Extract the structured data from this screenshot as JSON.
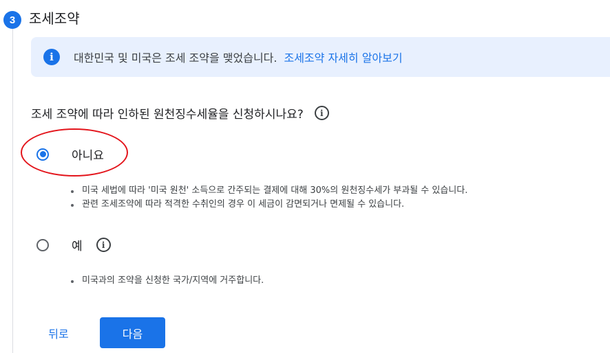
{
  "step": {
    "number": "3",
    "title": "조세조약"
  },
  "info": {
    "icon": "info-icon",
    "text": "대한민국 및 미국은 조세 조약을 맺었습니다.",
    "link": "조세조약 자세히 알아보기"
  },
  "question": {
    "text": "조세 조약에 따라 인하된 원천징수세율을 신청하시나요?",
    "help_icon": "help-icon"
  },
  "options": [
    {
      "label": "아니요",
      "selected": true,
      "bullets": [
        "미국 세법에 따라 '미국 원천' 소득으로 간주되는 결제에 대해 30%의 원천징수세가 부과될 수 있습니다.",
        "관련 조세조약에 따라 적격한 수취인의 경우 이 세금이 감면되거나 면제될 수 있습니다."
      ]
    },
    {
      "label": "예",
      "selected": false,
      "bullets": [
        "미국과의 조약을 신청한 국가/지역에 거주합니다."
      ]
    }
  ],
  "buttons": {
    "back": "뒤로",
    "next": "다음"
  },
  "colors": {
    "primary": "#1a73e8",
    "info_bg": "#e8f0fe",
    "annotation": "#e3141b"
  }
}
